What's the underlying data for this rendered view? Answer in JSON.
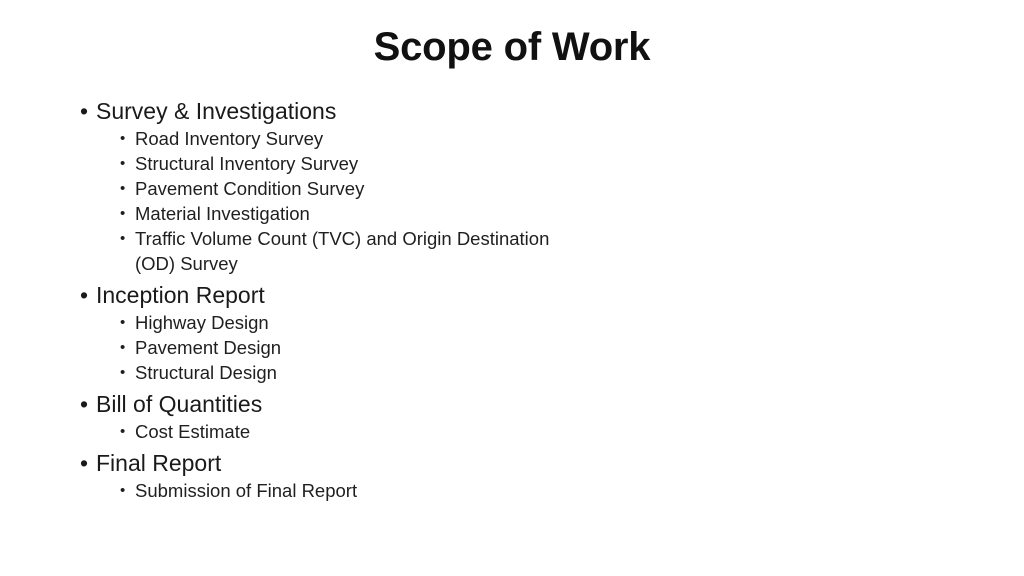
{
  "slide": {
    "title": "Scope of Work",
    "background_color": "#ffffff",
    "text_color": "#1a1a1a",
    "bullet_glyph_level1": "•",
    "bullet_glyph_level2": "•",
    "sections": [
      {
        "heading": "Survey & Investigations",
        "items": [
          "Road Inventory Survey",
          "Structural Inventory Survey",
          "Pavement Condition Survey",
          "Material Investigation",
          "Traffic Volume Count (TVC) and Origin Destination (OD) Survey"
        ]
      },
      {
        "heading": "Inception Report",
        "items": [
          "Highway Design",
          "Pavement Design",
          "Structural Design"
        ]
      },
      {
        "heading": "Bill of Quantities",
        "items": [
          "Cost Estimate"
        ]
      },
      {
        "heading": "Final Report",
        "items": [
          "Submission of Final Report"
        ]
      }
    ]
  }
}
